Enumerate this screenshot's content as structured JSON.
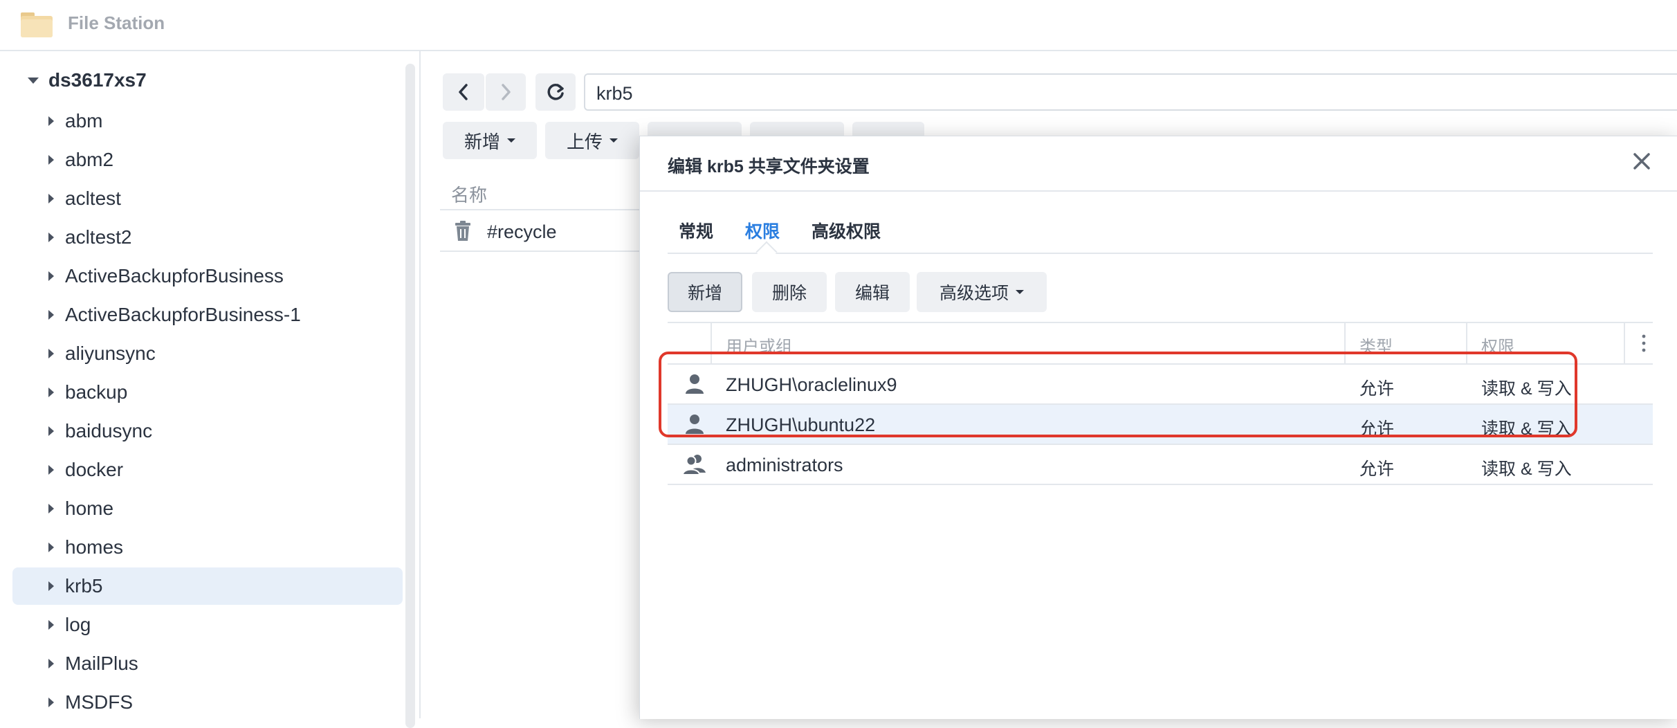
{
  "app": {
    "title": "File Station"
  },
  "sidebar": {
    "root": "ds3617xs7",
    "items": [
      {
        "label": "abm"
      },
      {
        "label": "abm2"
      },
      {
        "label": "acltest"
      },
      {
        "label": "acltest2"
      },
      {
        "label": "ActiveBackupforBusiness"
      },
      {
        "label": "ActiveBackupforBusiness-1"
      },
      {
        "label": "aliyunsync"
      },
      {
        "label": "backup"
      },
      {
        "label": "baidusync"
      },
      {
        "label": "docker"
      },
      {
        "label": "home"
      },
      {
        "label": "homes"
      },
      {
        "label": "krb5",
        "selected": true
      },
      {
        "label": "log"
      },
      {
        "label": "MailPlus"
      },
      {
        "label": "MSDFS"
      }
    ]
  },
  "main": {
    "path": "krb5",
    "toolbar": {
      "new_label": "新增",
      "upload_label": "上传"
    },
    "file_list": {
      "header_name": "名称",
      "rows": [
        {
          "name": "#recycle",
          "icon": "recycle-bin-icon"
        }
      ]
    }
  },
  "dialog": {
    "title": "编辑 krb5 共享文件夹设置",
    "tabs": [
      {
        "label": "常规",
        "active": false
      },
      {
        "label": "权限",
        "active": true
      },
      {
        "label": "高级权限",
        "active": false
      }
    ],
    "buttons": {
      "add": "新增",
      "delete": "删除",
      "edit": "编辑",
      "advanced": "高级选项"
    },
    "table": {
      "columns": {
        "user": "用户或组",
        "type": "类型",
        "permission": "权限"
      },
      "rows": [
        {
          "icon": "user-icon",
          "user": "ZHUGH\\oraclelinux9",
          "type": "允许",
          "permission": "读取 & 写入"
        },
        {
          "icon": "user-icon",
          "user": "ZHUGH\\ubuntu22",
          "type": "允许",
          "permission": "读取 & 写入"
        },
        {
          "icon": "group-icon",
          "user": "administrators",
          "type": "允许",
          "permission": "读取 & 写入"
        }
      ]
    }
  },
  "colors": {
    "accent": "#2a7ee0",
    "highlight": "#e0382b",
    "selected_bg": "#e7eff9"
  }
}
